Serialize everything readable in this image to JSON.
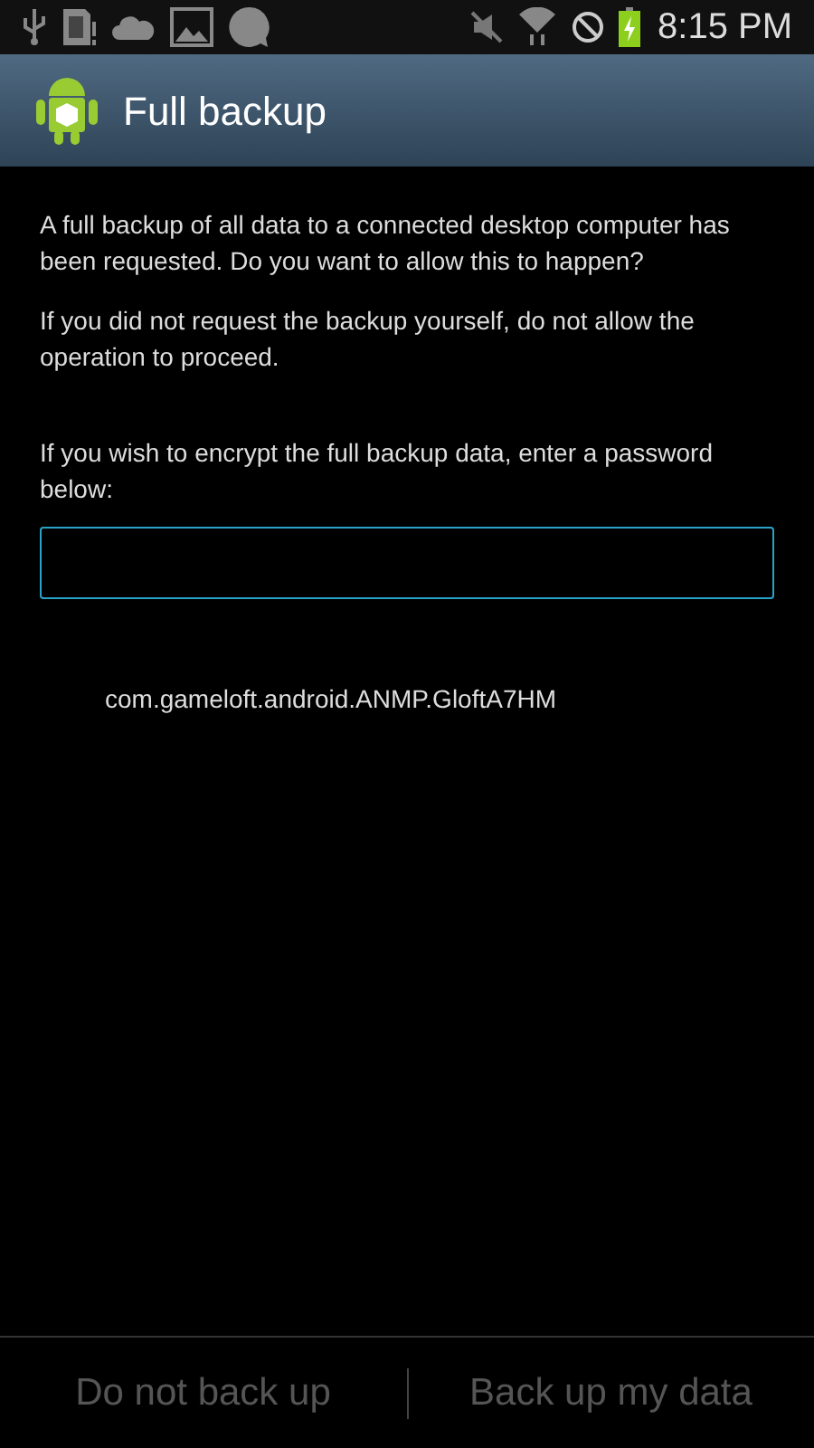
{
  "status_bar": {
    "time": "8:15 PM"
  },
  "title_bar": {
    "title": "Full backup"
  },
  "message": "A full backup of all data to a connected desktop computer has been requested. Do you want to allow this to happen?",
  "warning": "If you did not request the backup yourself, do not allow the operation to proceed.",
  "password_prompt": "If you wish to encrypt the full backup data, enter a password below:",
  "packages": [
    "com.gameloft.android.ANMP.GloftA7HM"
  ],
  "buttons": [
    {
      "label": "Do not back up",
      "disabled": true
    },
    {
      "label": "Back up my data",
      "disabled": true
    }
  ]
}
